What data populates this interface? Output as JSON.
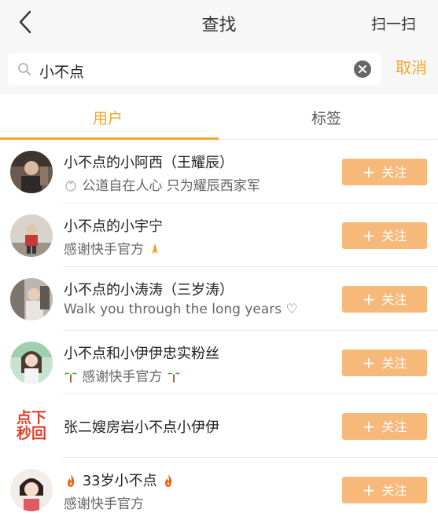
{
  "header": {
    "title": "查找",
    "scan_label": "扫一扫"
  },
  "search": {
    "query": "小不点",
    "cancel_label": "取消"
  },
  "tabs": [
    {
      "label": "用户",
      "active": true
    },
    {
      "label": "标签",
      "active": false
    }
  ],
  "accent_color": "#f5a623",
  "follow_label": "关注",
  "results": [
    {
      "name": "小不点的小阿西（王耀辰）",
      "desc": "公道自在人心 只为耀辰西家军",
      "desc_prefix_icon": "medal-icon"
    },
    {
      "name": "小不点的小宇宁",
      "desc": "感谢快手官方",
      "desc_suffix_icon": "pray-icon"
    },
    {
      "name": "小不点的小涛涛（三岁涛）",
      "desc": "Walk you through the long years ♡"
    },
    {
      "name": "小不点和小伊伊忠实粉丝",
      "desc": "感谢快手官方",
      "desc_prefix_icon": "palm-tree-icon",
      "desc_suffix_icon": "palm-tree-icon"
    },
    {
      "name": "张二嫂房岩小不点小伊伊",
      "desc": "",
      "avatar_text": "点下秒回"
    },
    {
      "name": "33岁小不点",
      "desc": "感谢快手官方",
      "name_prefix_icon": "fire-icon",
      "name_suffix_icon": "fire-icon"
    }
  ]
}
